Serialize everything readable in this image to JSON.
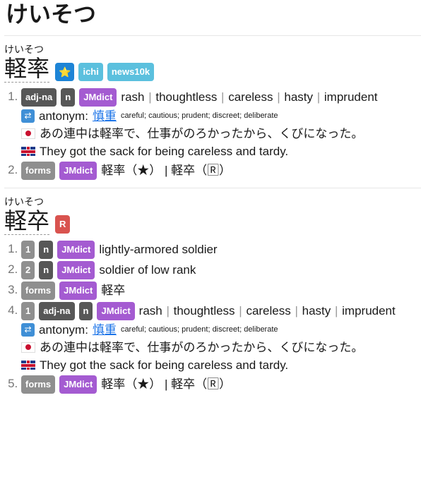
{
  "search_term": "けいそつ",
  "entries": [
    {
      "reading": "けいそつ",
      "kanji": "軽率",
      "tags": [
        {
          "label": "⭐",
          "color": "#1d84d6"
        },
        {
          "label": "ichi",
          "color": "#5bc0de"
        },
        {
          "label": "news10k",
          "color": "#5bc0de"
        }
      ],
      "senses": [
        {
          "tags": [
            "adj-na",
            "n",
            "JMdict"
          ],
          "glosses": [
            "rash",
            "thoughtless",
            "careless",
            "hasty",
            "imprudent"
          ],
          "antonym_label": "antonym:",
          "antonym_word": "慎重",
          "antonym_gloss": "careful; cautious; prudent; discreet; deliberate",
          "example_jp": "あの連中は軽率で、仕事がのろかったから、くびになった。",
          "example_en": "They got the sack for being careless and tardy."
        },
        {
          "tags": [
            "forms",
            "JMdict"
          ],
          "forms_text": "軽率（★） | 軽卒（🅁）"
        }
      ]
    },
    {
      "reading": "けいそつ",
      "kanji": "軽卒",
      "tags": [
        {
          "label": "R",
          "color": "#d9534f"
        }
      ],
      "senses": [
        {
          "tags": [
            "1",
            "n",
            "JMdict"
          ],
          "text": "lightly-armored soldier"
        },
        {
          "tags": [
            "2",
            "n",
            "JMdict"
          ],
          "text": "soldier of low rank"
        },
        {
          "tags": [
            "forms",
            "JMdict"
          ],
          "text": "軽卒"
        },
        {
          "tags": [
            "1",
            "adj-na",
            "n",
            "JMdict"
          ],
          "glosses": [
            "rash",
            "thoughtless",
            "careless",
            "hasty",
            "imprudent"
          ],
          "antonym_label": "antonym:",
          "antonym_word": "慎重",
          "antonym_gloss": "careful; cautious; prudent; discreet; deliberate",
          "example_jp": "あの連中は軽率で、仕事がのろかったから、くびになった。",
          "example_en": "They got the sack for being careless and tardy."
        },
        {
          "tags": [
            "forms",
            "JMdict"
          ],
          "forms_text": "軽率（★） | 軽卒（🅁）"
        }
      ]
    }
  ],
  "icons": {
    "antonym": "swap-arrows-icon",
    "japanese_example": "japan-flag-icon",
    "english_example": "uk-flag-icon"
  }
}
